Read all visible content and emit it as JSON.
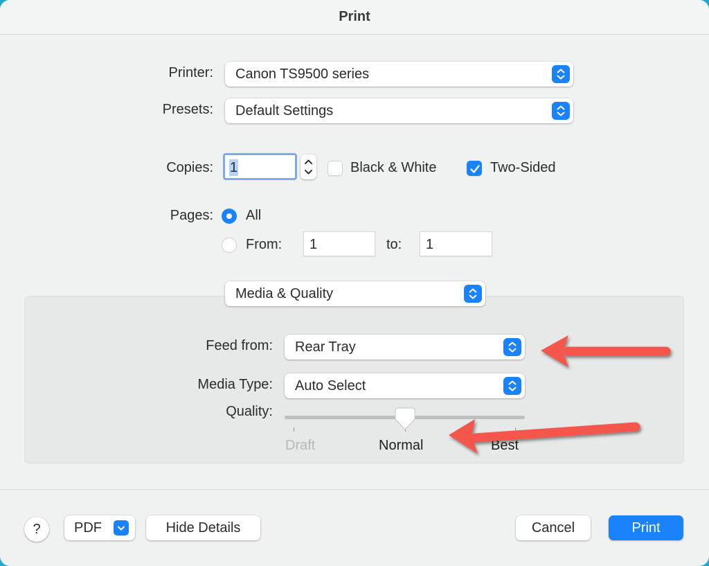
{
  "window": {
    "title": "Print"
  },
  "printer": {
    "label": "Printer:",
    "value": "Canon TS9500 series"
  },
  "presets": {
    "label": "Presets:",
    "value": "Default Settings"
  },
  "copies": {
    "label": "Copies:",
    "value": "1",
    "black_white": {
      "label": "Black & White",
      "checked": false
    },
    "two_sided": {
      "label": "Two-Sided",
      "checked": true
    }
  },
  "pages": {
    "label": "Pages:",
    "all_label": "All",
    "from_label": "From:",
    "to_label": "to:",
    "selected": "All",
    "from_value": "1",
    "to_value": "1"
  },
  "section_popup": {
    "value": "Media & Quality"
  },
  "media": {
    "feed_from": {
      "label": "Feed from:",
      "value": "Rear Tray"
    },
    "media_type": {
      "label": "Media Type:",
      "value": "Auto Select"
    },
    "quality": {
      "label": "Quality:",
      "options": [
        "Draft",
        "Normal",
        "Best"
      ],
      "selected": "Normal",
      "draft_enabled": false
    }
  },
  "footer": {
    "help_label": "?",
    "pdf_label": "PDF",
    "hide_details_label": "Hide Details",
    "cancel_label": "Cancel",
    "print_label": "Print"
  },
  "colors": {
    "accent": "#1a82fb",
    "annotation_arrow": "#f4574b",
    "window_bg": "#f0f1f1",
    "details_bg": "#e7e8e8"
  },
  "annotations": [
    {
      "type": "arrow",
      "points_to": "feed-from-popup"
    },
    {
      "type": "arrow",
      "points_to": "quality-slider-normal"
    }
  ]
}
